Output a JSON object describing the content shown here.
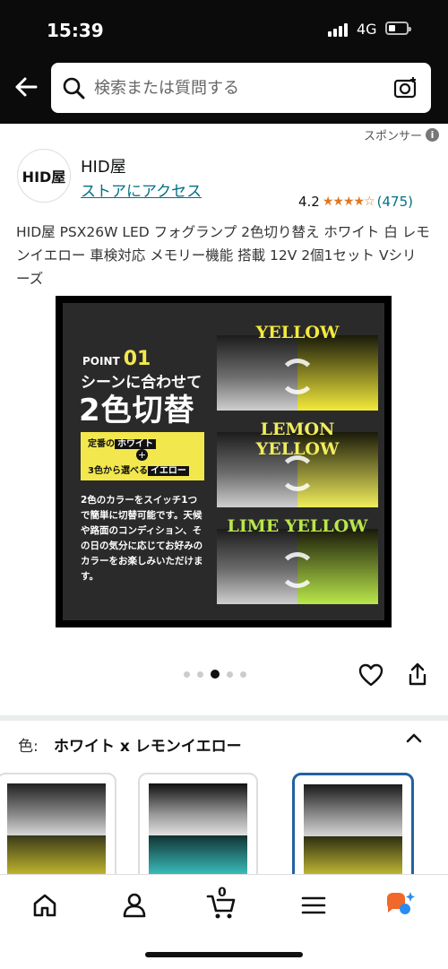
{
  "status": {
    "time": "15:39",
    "network": "4G"
  },
  "search": {
    "placeholder": "検索または質問する"
  },
  "sponsored": {
    "label": "スポンサー"
  },
  "store": {
    "logo_text": "HID屋",
    "name": "HID屋",
    "link": "ストアにアクセス"
  },
  "rating": {
    "value": "4.2",
    "stars": "★★★★☆",
    "count": "(475)"
  },
  "product": {
    "title": "HID屋 PSX26W LED フォグランプ 2色切り替え ホワイト 白 レモンイエロー 車検対応 メモリー機能 搭載 12V 2個1セット Vシリーズ"
  },
  "image": {
    "point_label": "POINT",
    "point_num": "01",
    "headline1": "シーンに合わせて",
    "headline2": "2色切替",
    "box_line1_a": "定番の",
    "box_line1_b": "ホワイト",
    "box_plus": "+",
    "box_line2_a": "3色から選べる",
    "box_line2_b": "イエロー",
    "desc": "2色のカラーをスイッチ1つで簡単に切替可能です。天候や路面のコンディション、その日の気分に応じてお好みのカラーをお楽しみいただけます。",
    "panels": [
      {
        "title": "YELLOW",
        "color": "#f3ea3c"
      },
      {
        "title": "LEMON YELLOW",
        "color": "#f0ed5c"
      },
      {
        "title": "LIME YELLOW",
        "color": "#b9e84a"
      }
    ]
  },
  "carousel": {
    "count": 5,
    "active": 2
  },
  "color_selector": {
    "label": "色:",
    "value": "ホワイト x レモンイエロー"
  },
  "cart": {
    "count": "0"
  },
  "colors": {
    "accent_link": "#007185",
    "star": "#de7921",
    "selected_border": "#2162a1"
  }
}
